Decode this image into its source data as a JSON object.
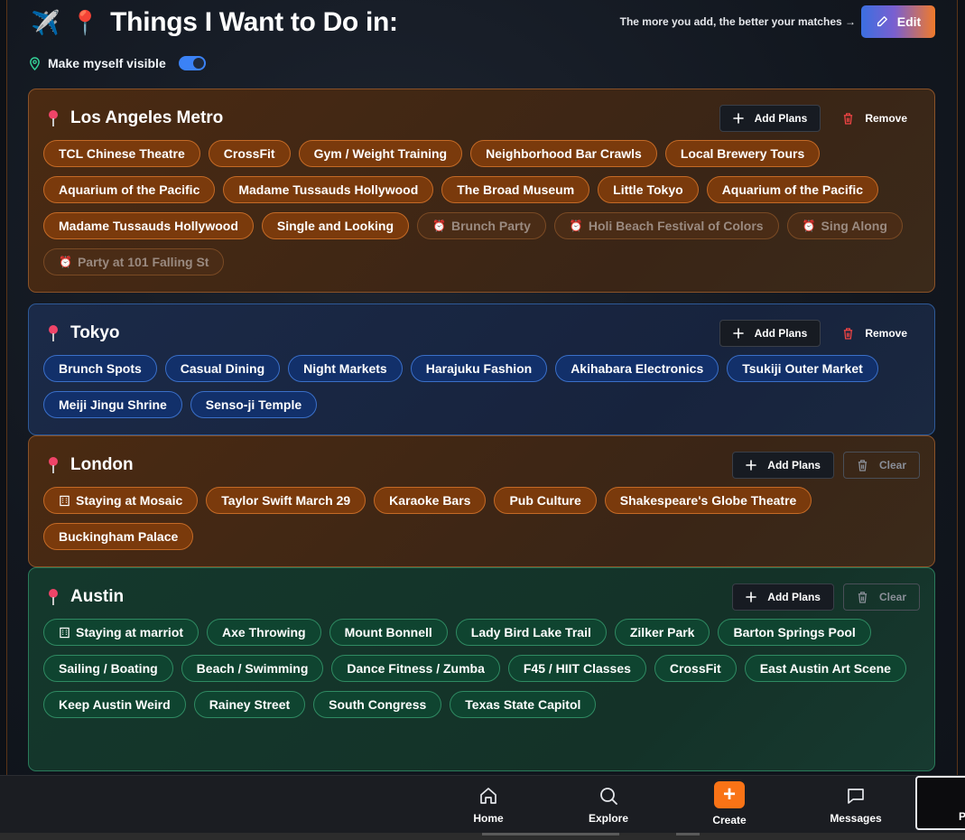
{
  "header": {
    "title": "Things I Want to Do in:",
    "title_emoji_1": "✈️",
    "title_emoji_2": "📍",
    "hint": "The more you add, the better your matches →",
    "edit_label": "Edit",
    "visible_label": "Make myself visible",
    "visible_on": true
  },
  "labels": {
    "add_plans": "Add Plans",
    "remove": "Remove",
    "clear": "Clear"
  },
  "cities": [
    {
      "name": "Los Angeles Metro",
      "theme": "orange",
      "action": "remove",
      "chips": [
        {
          "label": "TCL Chinese Theatre"
        },
        {
          "label": "CrossFit"
        },
        {
          "label": "Gym / Weight Training"
        },
        {
          "label": "Neighborhood Bar Crawls"
        },
        {
          "label": "Local Brewery Tours"
        },
        {
          "label": "Aquarium of the Pacific"
        },
        {
          "label": "Madame Tussauds Hollywood"
        },
        {
          "label": "The Broad Museum"
        },
        {
          "label": "Little Tokyo"
        },
        {
          "label": "Aquarium of the Pacific"
        },
        {
          "label": "Madame Tussauds Hollywood"
        },
        {
          "label": "Single and Looking"
        },
        {
          "label": "Brunch Party",
          "icon": "alarm-icon",
          "faded": true
        },
        {
          "label": "Holi Beach Festival of Colors",
          "icon": "alarm-icon",
          "faded": true
        },
        {
          "label": "Sing Along",
          "icon": "alarm-icon",
          "faded": true
        },
        {
          "label": "Party at 101 Falling St",
          "icon": "alarm-icon",
          "faded": true
        }
      ]
    },
    {
      "name": "Tokyo",
      "theme": "blue",
      "action": "remove",
      "chips": [
        {
          "label": "Brunch Spots"
        },
        {
          "label": "Casual Dining"
        },
        {
          "label": "Night Markets"
        },
        {
          "label": "Harajuku Fashion"
        },
        {
          "label": "Akihabara Electronics"
        },
        {
          "label": "Tsukiji Outer Market"
        },
        {
          "label": "Meiji Jingu Shrine"
        },
        {
          "label": "Senso-ji Temple"
        }
      ]
    },
    {
      "name": "London",
      "theme": "orange",
      "action": "clear",
      "chips": [
        {
          "label": "Staying at Mosaic",
          "icon": "hotel-icon"
        },
        {
          "label": "Taylor Swift March 29"
        },
        {
          "label": "Karaoke Bars"
        },
        {
          "label": "Pub Culture"
        },
        {
          "label": "Shakespeare's Globe Theatre"
        },
        {
          "label": "Buckingham Palace"
        }
      ]
    },
    {
      "name": "Austin",
      "theme": "green",
      "action": "clear",
      "chips": [
        {
          "label": "Staying at marriot",
          "icon": "hotel-icon"
        },
        {
          "label": "Axe Throwing"
        },
        {
          "label": "Mount Bonnell"
        },
        {
          "label": "Lady Bird Lake Trail"
        },
        {
          "label": "Zilker Park"
        },
        {
          "label": "Barton Springs Pool"
        },
        {
          "label": "Sailing / Boating"
        },
        {
          "label": "Beach / Swimming"
        },
        {
          "label": "Dance Fitness / Zumba"
        },
        {
          "label": "F45 / HIIT Classes"
        },
        {
          "label": "CrossFit"
        },
        {
          "label": "East Austin Art Scene"
        },
        {
          "label": "Keep Austin Weird"
        },
        {
          "label": "Rainey Street"
        },
        {
          "label": "South Congress"
        },
        {
          "label": "Texas State Capitol"
        }
      ]
    }
  ],
  "nav": {
    "home": "Home",
    "explore": "Explore",
    "create": "Create",
    "create_symbol": "+",
    "messages": "Messages",
    "profile_initial": "P"
  },
  "colors": {
    "accent_orange": "#f97316",
    "accent_blue": "#3b82f6",
    "pin_red": "#ef4468"
  }
}
